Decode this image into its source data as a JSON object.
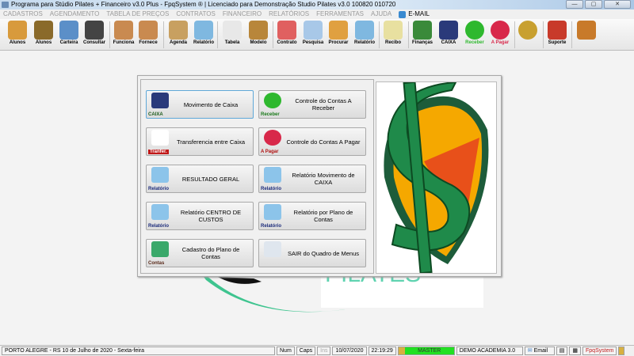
{
  "window": {
    "title": "Programa para Stúdio Pilates + Financeiro v3.0 Plus - FpqSystem ® | Licenciado para  Demonstração Studio Pilates v3.0 100820 010720",
    "minimize": "—",
    "maximize": "▢",
    "close": "✕"
  },
  "menu": [
    "CADASTROS",
    "AGENDAMENTO",
    "TABELA DE PREÇOS",
    "CONTRATOS",
    "FINANCEIRO",
    "RELATÓRIOS",
    "FERRAMENTAS",
    "AJUDA"
  ],
  "menu_email": "E-MAIL",
  "toolbar": [
    {
      "label": "Alunos",
      "color": "#d89a3c"
    },
    {
      "label": "Alunos",
      "color": "#8a6a2a"
    },
    {
      "label": "Carteira",
      "color": "#5b8fc8"
    },
    {
      "label": "Consultar",
      "color": "#444444"
    },
    {
      "label": "Funciona",
      "color": "#c98a50"
    },
    {
      "label": "Fornece",
      "color": "#c98a50"
    },
    {
      "label": "Agenda",
      "color": "#c8a060"
    },
    {
      "label": "Relatório",
      "color": "#7fb8e0"
    },
    {
      "label": "Tabela",
      "color": "#e8e8e8"
    },
    {
      "label": "Modelo",
      "color": "#b8863a"
    },
    {
      "label": "Contrato",
      "color": "#e06060"
    },
    {
      "label": "Pesquisa",
      "color": "#a8c8e8"
    },
    {
      "label": "Procurar",
      "color": "#e0a040"
    },
    {
      "label": "Relatório",
      "color": "#7fb8e0"
    },
    {
      "label": "Recibo",
      "color": "#e8e0a0"
    },
    {
      "label": "Finanças",
      "color": "#3a8a3a"
    },
    {
      "label": "CAIXA",
      "color": "#2a3a7a"
    },
    {
      "label": "Receber",
      "color": "#2eb82e"
    },
    {
      "label": "A Pagar",
      "color": "#d8284a"
    },
    {
      "label": "",
      "color": "#c8a030"
    },
    {
      "label": "Suporte",
      "color": "#c83a2a"
    },
    {
      "label": "",
      "color": "#c87a2a"
    }
  ],
  "buttons": [
    {
      "label": "Movimento de Caixa",
      "caption": "CAIXA",
      "caption_color": "#1a5a1a",
      "icon_color": "#2a3a7a"
    },
    {
      "label": "Controle do Contas A Receber",
      "caption": "Receber",
      "caption_color": "#1a7a1a",
      "icon_color": "#2eb82e"
    },
    {
      "label": "Transferencia entre Caixa",
      "caption": "Tranfer.",
      "caption_color": "#ffffff",
      "icon_color": "#ffffff"
    },
    {
      "label": "Controle do Contas A Pagar",
      "caption": "A Pagar",
      "caption_color": "#b01010",
      "icon_color": "#d8284a"
    },
    {
      "label": "RESULTADO GERAL",
      "caption": "Relatório",
      "caption_color": "#1a2a7a",
      "icon_color": "#8cc4ea"
    },
    {
      "label": "Relatório Movimento de CAIXA",
      "caption": "Relatório",
      "caption_color": "#1a2a7a",
      "icon_color": "#8cc4ea"
    },
    {
      "label": "Relatório CENTRO DE CUSTOS",
      "caption": "Relatório",
      "caption_color": "#1a2a7a",
      "icon_color": "#8cc4ea"
    },
    {
      "label": "Relatório por Plano de Contas",
      "caption": "Relatório",
      "caption_color": "#1a2a7a",
      "icon_color": "#8cc4ea"
    },
    {
      "label": "Cadastro do Plano de Contas",
      "caption": "Contas",
      "caption_color": "#5a2a1a",
      "icon_color": "#3aa86a"
    },
    {
      "label": "SAIR do Quadro de Menus",
      "caption": "",
      "caption_color": "#000000",
      "icon_color": "#dfe6ee"
    }
  ],
  "status": {
    "location": "PORTO ALEGRE - RS 10 de Julho de 2020 - Sexta-feira",
    "num": "Num",
    "caps": "Caps",
    "ins": "Ins",
    "date": "10/07/2020",
    "time": "22:19:29",
    "user": "MASTER",
    "company": "DEMO ACADEMIA 3.0",
    "email": "Email",
    "brand": "FpqSystem"
  }
}
